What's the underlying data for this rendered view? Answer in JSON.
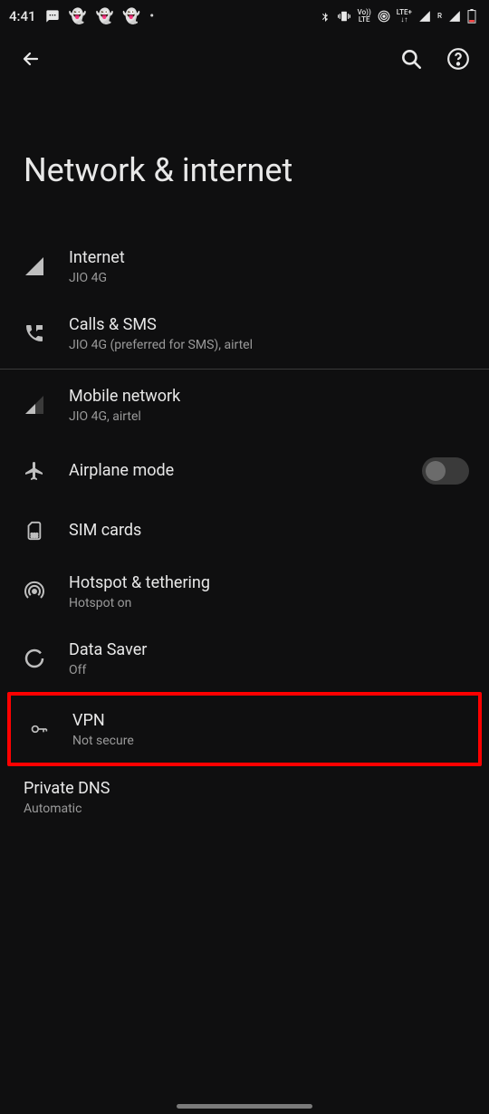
{
  "status": {
    "time": "4:41",
    "icons_left": [
      "message-icon",
      "ghost-icon",
      "ghost-icon",
      "ghost-icon",
      "dot-icon"
    ],
    "icons_right": [
      "bluetooth-icon",
      "vibrate-icon",
      "volte-label",
      "hotspot-icon",
      "lte-plus-label",
      "signal-icon",
      "r-label",
      "signal-icon",
      "battery-low-icon"
    ]
  },
  "appbar": {
    "back": "Back",
    "search": "Search",
    "help": "Help"
  },
  "page_title": "Network & internet",
  "items": {
    "internet": {
      "title": "Internet",
      "sub": "JIO 4G"
    },
    "calls": {
      "title": "Calls & SMS",
      "sub": "JIO 4G (preferred for SMS), airtel"
    },
    "mobile": {
      "title": "Mobile network",
      "sub": "JIO 4G, airtel"
    },
    "airplane": {
      "title": "Airplane mode",
      "on": false
    },
    "sim": {
      "title": "SIM cards"
    },
    "hotspot": {
      "title": "Hotspot & tethering",
      "sub": "Hotspot on"
    },
    "datasaver": {
      "title": "Data Saver",
      "sub": "Off"
    },
    "vpn": {
      "title": "VPN",
      "sub": "Not secure"
    },
    "dns": {
      "title": "Private DNS",
      "sub": "Automatic"
    }
  }
}
